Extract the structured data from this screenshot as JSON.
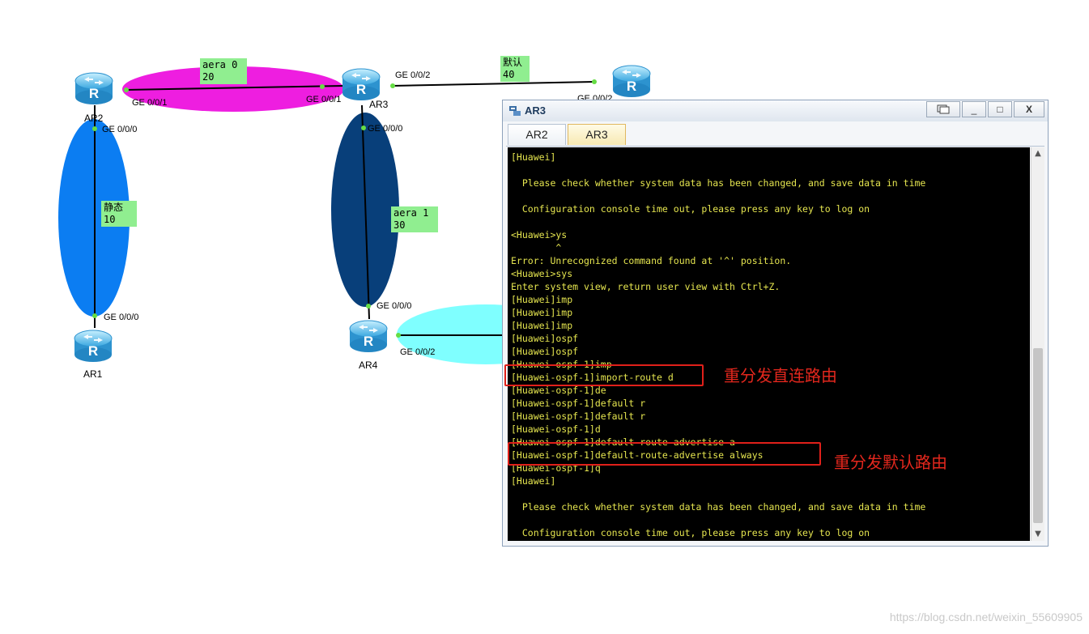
{
  "topology": {
    "routers": [
      {
        "id": "AR2",
        "label": "AR2",
        "icon": "router-icon"
      },
      {
        "id": "AR3",
        "label": "AR3",
        "icon": "router-icon"
      },
      {
        "id": "AR1",
        "label": "AR1",
        "icon": "router-icon"
      },
      {
        "id": "AR4",
        "label": "AR4",
        "icon": "router-icon"
      },
      {
        "id": "AR5",
        "label": "",
        "icon": "router-icon"
      }
    ],
    "ports": {
      "ar2_ge001": "GE 0/0/1",
      "ar2_ge000": "GE 0/0/0",
      "ar3_ge001": "GE 0/0/1",
      "ar3_ge002": "GE 0/0/2",
      "ar3_ge000": "GE 0/0/0",
      "ar1_ge000": "GE 0/0/0",
      "ar4_ge000": "GE 0/0/0",
      "ar4_ge002": "GE 0/0/2",
      "ar5_ge002": "GE 0/0/2"
    },
    "notes": [
      {
        "line1": "aera 0",
        "line2": "20"
      },
      {
        "line1": "默认",
        "line2": "40"
      },
      {
        "line1": "静态",
        "line2": "10"
      },
      {
        "line1": "aera 1",
        "line2": "30"
      }
    ],
    "colors": {
      "area0": "#ee1ee0",
      "static": "#0b7df2",
      "area1": "#083f7a",
      "ar4_link": "#7fffff",
      "note_bg": "#90ee90"
    }
  },
  "console": {
    "title": "AR3",
    "tabs": [
      {
        "label": "AR2",
        "active": false
      },
      {
        "label": "AR3",
        "active": true
      }
    ],
    "lines": [
      "[Huawei]",
      "",
      "  Please check whether system data has been changed, and save data in time",
      "",
      "  Configuration console time out, please press any key to log on",
      "",
      "<Huawei>ys",
      "        ^",
      "Error: Unrecognized command found at '^' position.",
      "<Huawei>sys",
      "Enter system view, return user view with Ctrl+Z.",
      "[Huawei]imp",
      "[Huawei]imp",
      "[Huawei]imp",
      "[Huawei]ospf",
      "[Huawei]ospf",
      "[Huawei-ospf-1]imp",
      "[Huawei-ospf-1]import-route d",
      "[Huawei-ospf-1]de",
      "[Huawei-ospf-1]default r",
      "[Huawei-ospf-1]default r",
      "[Huawei-ospf-1]d",
      "[Huawei-ospf-1]default-route-advertise a",
      "[Huawei-ospf-1]default-route-advertise always",
      "[Huawei-ospf-1]q",
      "[Huawei]",
      "",
      "  Please check whether system data has been changed, and save data in time",
      "",
      "  Configuration console time out, please press any key to log on"
    ],
    "window_buttons": {
      "minimize": "_",
      "maximize": "□",
      "close": "X"
    }
  },
  "annotations": {
    "redistribute_direct": "重分发直连路由",
    "redistribute_default": "重分发默认路由"
  },
  "watermark": "https://blog.csdn.net/weixin_55609905"
}
